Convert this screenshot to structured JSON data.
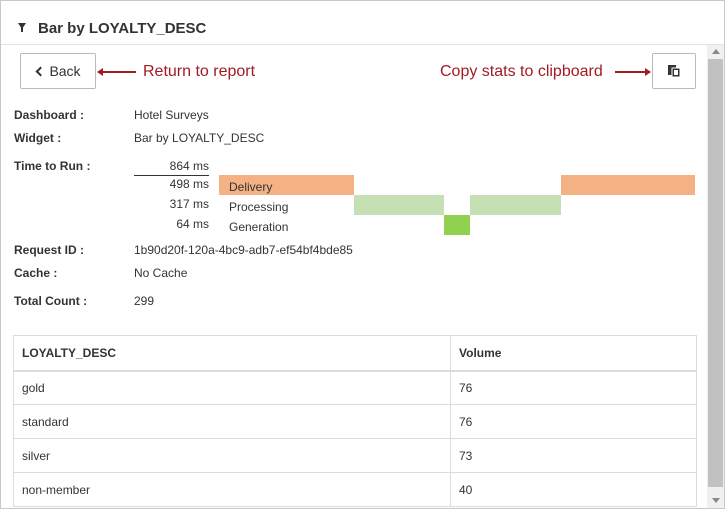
{
  "header": {
    "title": "Bar by LOYALTY_DESC",
    "icon": "filter-icon"
  },
  "toolbar": {
    "back_label": "Back",
    "copy_icon": "clipboard-icon"
  },
  "annotations": {
    "back": "Return to report",
    "copy": "Copy stats to clipboard",
    "color": "#a11c22"
  },
  "info": {
    "dashboard_label": "Dashboard :",
    "dashboard_value": "Hotel Surveys",
    "widget_label": "Widget :",
    "widget_value": "Bar by LOYALTY_DESC",
    "time_label": "Time to Run :",
    "request_label": "Request ID :",
    "request_value": "1b90d20f-120a-4bc9-adb7-ef54bf4bde85",
    "cache_label": "Cache :",
    "cache_value": "No Cache",
    "total_label": "Total Count :",
    "total_value": "299"
  },
  "timing": {
    "total": "864 ms",
    "phases": [
      {
        "name": "Delivery",
        "time": "498 ms",
        "color": "#f4b183"
      },
      {
        "name": "Processing",
        "time": "317 ms",
        "color": "#c5e0b4"
      },
      {
        "name": "Generation",
        "time": "64 ms",
        "color": "#92d050"
      }
    ]
  },
  "table": {
    "headers": [
      "LOYALTY_DESC",
      "Volume"
    ],
    "rows": [
      [
        "gold",
        "76"
      ],
      [
        "standard",
        "76"
      ],
      [
        "silver",
        "73"
      ],
      [
        "non-member",
        "40"
      ]
    ]
  }
}
